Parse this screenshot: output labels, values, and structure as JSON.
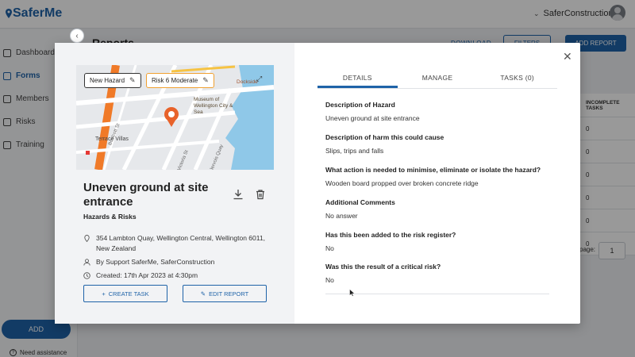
{
  "app": {
    "name": "SaferMe",
    "org": "SaferConstruction"
  },
  "sidebar": {
    "items": [
      {
        "label": "Dashboard",
        "icon": "dashboard-icon"
      },
      {
        "label": "Forms",
        "icon": "forms-icon",
        "active": true
      },
      {
        "label": "Members",
        "icon": "members-icon"
      },
      {
        "label": "Risks",
        "icon": "risks-icon"
      },
      {
        "label": "Training",
        "icon": "training-icon"
      }
    ],
    "add_label": "ADD",
    "assist_label": "Need assistance"
  },
  "page": {
    "title": "Reports",
    "download_label": "DOWNLOAD",
    "filters_label": "FILTERS",
    "add_report_label": "ADD REPORT",
    "table": {
      "header": "INCOMPLETE TASKS",
      "rows": [
        "0",
        "0",
        "0",
        "0",
        "0",
        "0"
      ]
    },
    "page_label": "page:",
    "page_value": "1"
  },
  "modal": {
    "map": {
      "hazard_chip": "New Hazard",
      "risk_chip": "Risk 6 Moderate",
      "labels": {
        "museum": "Museum of Wellington City & Sea",
        "terrace": "Terrace Villas",
        "dockside": "Dockside",
        "boulcott": "Boulcott St",
        "victoria": "Victoria St",
        "jervois": "Jervois Quay"
      }
    },
    "report": {
      "title": "Uneven ground at site entrance",
      "category": "Hazards & Risks",
      "address": "354 Lambton Quay, Wellington Central, Wellington 6011, New Zealand",
      "author": "By Support SaferMe, SaferConstruction",
      "created": "Created: 17th Apr 2023 at 4:30pm",
      "create_task_label": "CREATE TASK",
      "edit_report_label": "EDIT REPORT"
    },
    "tabs": [
      {
        "label": "DETAILS",
        "active": true
      },
      {
        "label": "MANAGE"
      },
      {
        "label": "TASKS (0)"
      }
    ],
    "details": [
      {
        "question": "Description of Hazard",
        "answer": "Uneven ground at site entrance"
      },
      {
        "question": "Description of harm this could cause",
        "answer": "Slips, trips and falls"
      },
      {
        "question": "What action is needed to minimise, eliminate or isolate the hazard?",
        "answer": "Wooden board propped over broken concrete ridge"
      },
      {
        "question": "Additional Comments",
        "answer": "No answer"
      },
      {
        "question": "Has this been added to the risk register?",
        "answer": "No"
      },
      {
        "question": "Was this the result of a critical risk?",
        "answer": "No"
      }
    ]
  },
  "colors": {
    "brand": "#1f63a8",
    "risk_moderate": "#f0a030",
    "hazard_marker": "#e8622a",
    "water": "#8fc8e8"
  }
}
